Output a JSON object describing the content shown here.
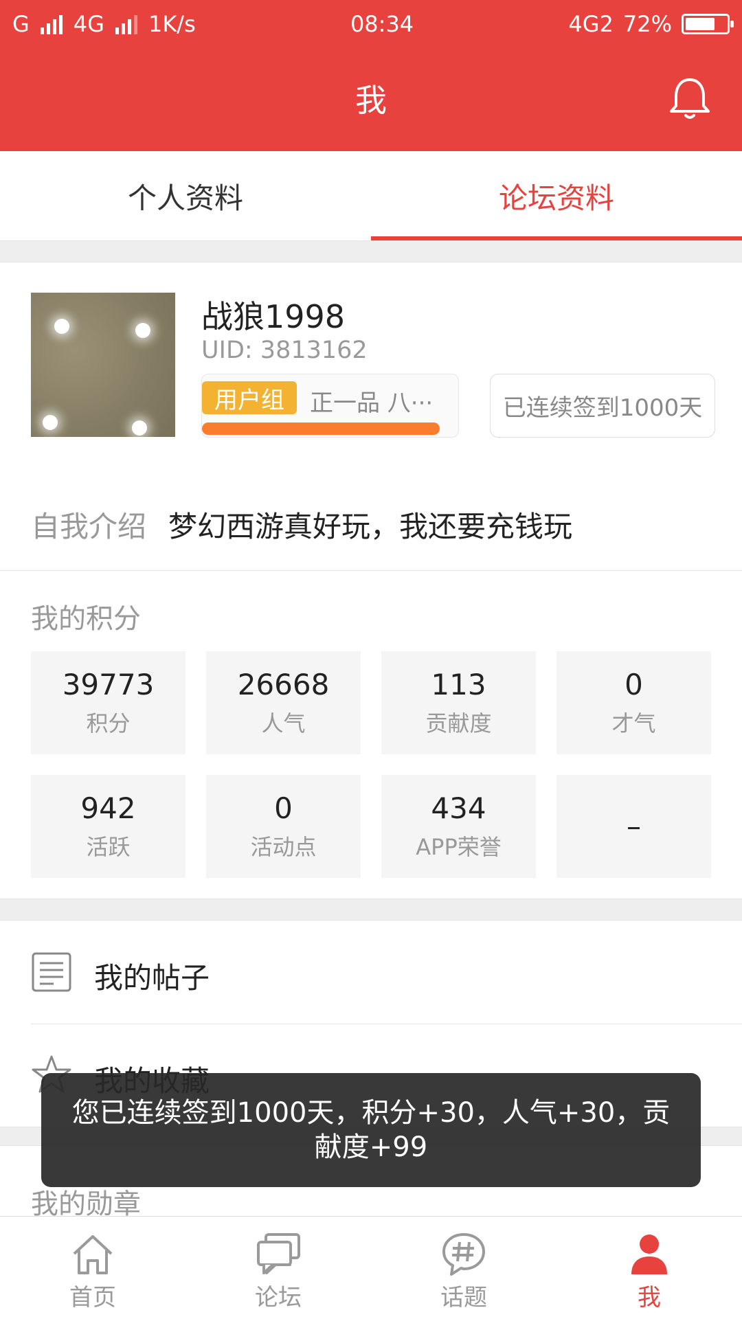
{
  "status_bar": {
    "carrier1": "G",
    "network2": "4G",
    "speed": "1K/s",
    "time": "08:34",
    "net_right": "4G2",
    "battery": "72%",
    "battery_level": 0.72
  },
  "header": {
    "title": "我"
  },
  "tabs": [
    {
      "label": "个人资料",
      "active": false
    },
    {
      "label": "论坛资料",
      "active": true
    }
  ],
  "profile": {
    "username": "战狼1998",
    "uid": "UID: 3813162",
    "group_badge": "用户组",
    "group_name": "正一品 八···",
    "checkin": "已连续签到1000天",
    "intro_label": "自我介绍",
    "intro_text": "梦幻西游真好玩，我还要充钱玩"
  },
  "points": {
    "title": "我的积分",
    "stats": [
      {
        "value": "39773",
        "label": "积分"
      },
      {
        "value": "26668",
        "label": "人气"
      },
      {
        "value": "113",
        "label": "贡献度"
      },
      {
        "value": "0",
        "label": "才气"
      },
      {
        "value": "942",
        "label": "活跃"
      },
      {
        "value": "0",
        "label": "活动点"
      },
      {
        "value": "434",
        "label": "APP荣誉"
      },
      {
        "value": "–",
        "label": ""
      }
    ]
  },
  "menu": {
    "posts": "我的帖子",
    "favorites": "我的收藏",
    "medals_title": "我的勋章"
  },
  "toast": {
    "text": "您已连续签到1000天，积分+30，人气+30，贡献度+99"
  },
  "bottom_nav": [
    {
      "label": "首页",
      "icon": "home-icon"
    },
    {
      "label": "论坛",
      "icon": "chat-icon"
    },
    {
      "label": "话题",
      "icon": "hashtag-icon"
    },
    {
      "label": "我",
      "icon": "user-icon",
      "active": true
    }
  ],
  "colors": {
    "brand": "#e8423f",
    "badge": "#f4b232",
    "progress": "#fa7d2e"
  }
}
